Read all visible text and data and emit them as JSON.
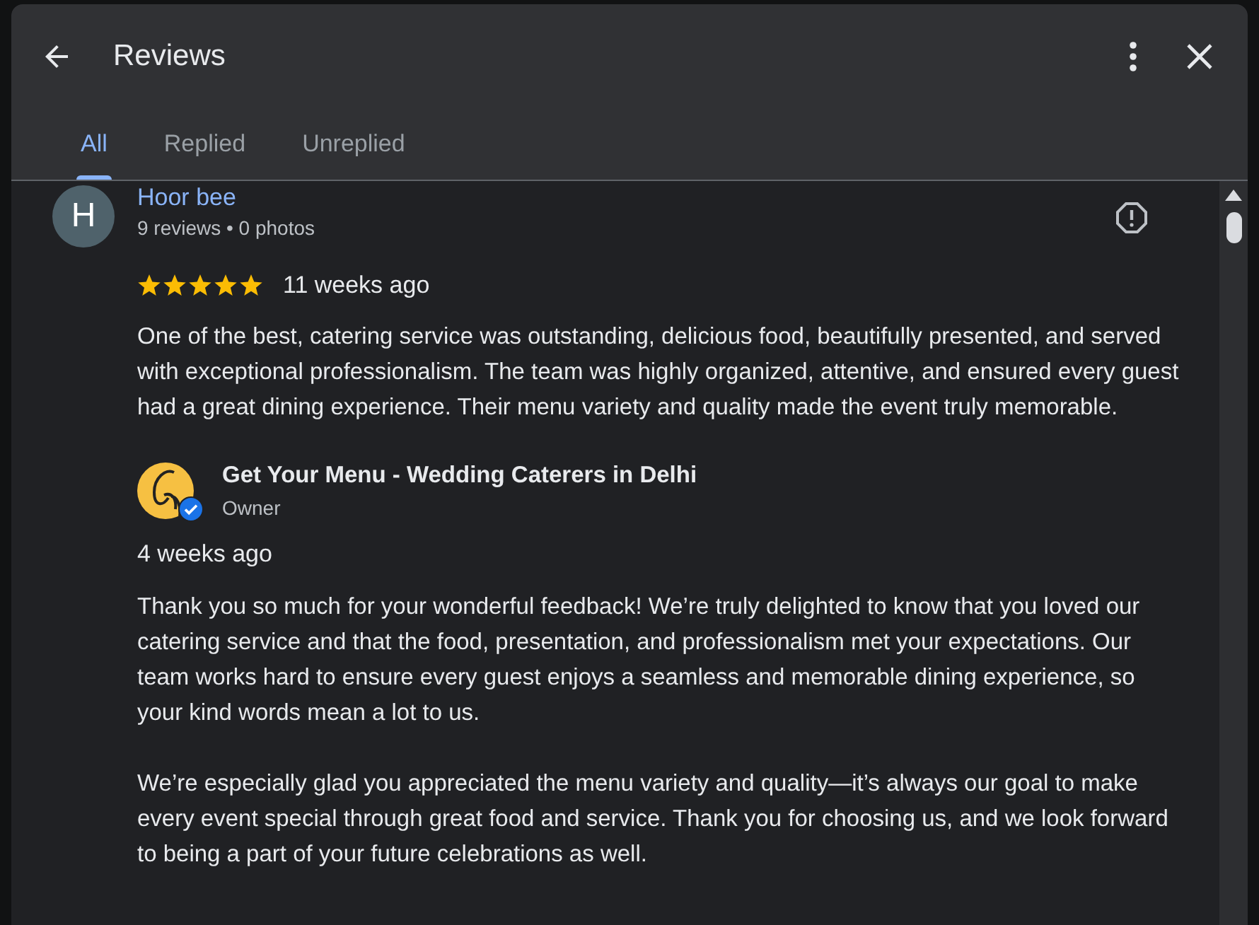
{
  "header": {
    "title": "Reviews"
  },
  "tabs": [
    {
      "label": "All",
      "selected": true
    },
    {
      "label": "Replied",
      "selected": false
    },
    {
      "label": "Unreplied",
      "selected": false
    }
  ],
  "review": {
    "author": "Hoor bee",
    "avatar_letter": "H",
    "meta": "9 reviews • 0 photos",
    "stars": 5,
    "time": "11 weeks ago",
    "text": "One of the best, catering service was outstanding, delicious food, beautifully presented, and served with exceptional professionalism. The team was highly organized, attentive, and ensured every guest had a great dining experience. Their menu variety and quality made the event truly memorable."
  },
  "reply": {
    "owner": "Get Your Menu - Wedding Caterers in Delhi",
    "role": "Owner",
    "verified": true,
    "time": "4 weeks ago",
    "paragraphs": [
      "Thank you so much for your wonderful feedback! We’re truly delighted to know that you loved our catering service and that the food, presentation, and professionalism met your expectations. Our team works hard to ensure every guest enjoys a seamless and memorable dining experience, so your kind words mean a lot to us.",
      "We’re especially glad you appreciated the menu variety and quality—it’s always our goal to make every event special through great food and service. Thank you for choosing us, and we look forward to being a part of your future celebrations as well."
    ]
  }
}
